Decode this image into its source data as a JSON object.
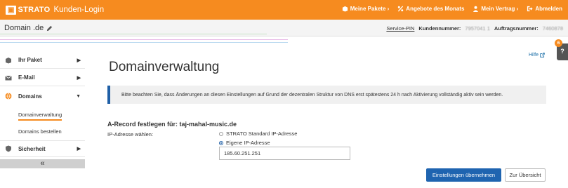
{
  "header": {
    "logo_box": "▣",
    "brand": "STRATO",
    "app_title": "Kunden-Login",
    "nav": [
      {
        "label": "Meine Pakete ›",
        "icon": "package-icon"
      },
      {
        "label": "Angebote des Monats",
        "icon": "percent-icon"
      },
      {
        "label": "Mein Vertrag ›",
        "icon": "user-icon"
      },
      {
        "label": "Abmelden",
        "icon": "logout-icon"
      }
    ]
  },
  "subbar": {
    "domain": "Domain .de",
    "service_pin": "Service-PIN",
    "kundennummer_label": "Kundennummer:",
    "kundennummer_value": "7957041 1",
    "auftragsnummer_label": "Auftragsnummer:",
    "auftragsnummer_value": "7460878"
  },
  "sidebar": {
    "items": [
      {
        "label": "Ihr Paket",
        "icon": "package-icon"
      },
      {
        "label": "E-Mail",
        "icon": "mail-icon"
      },
      {
        "label": "Domains",
        "icon": "globe-icon"
      },
      {
        "label": "Sicherheit",
        "icon": "shield-icon"
      }
    ],
    "sub_items": [
      "Domainverwaltung",
      "Domains bestellen"
    ],
    "collapse": "«"
  },
  "main": {
    "title": "Domainverwaltung",
    "help": "Hilfe",
    "notice": "Bitte beachten Sie, dass Änderungen an diesen Einstellungen auf Grund der dezentralen Struktur von DNS erst spätestens 24 h nach Aktivierung vollständig aktiv sein werden.",
    "section_title": "A-Record festlegen für: taj-mahal-music.de",
    "ip_label": "IP-Adresse wählen:",
    "radio_standard": "STRATO Standard IP-Adresse",
    "radio_custom": "Eigene IP-Adresse",
    "ip_value": "185.60.251.251",
    "btn_apply": "Einstellungen übernehmen",
    "btn_overview": "Zur Übersicht"
  },
  "side_badge": "6",
  "side_help": "?",
  "colors": {
    "accent": "#f68b1f",
    "primary": "#1f64b0"
  }
}
